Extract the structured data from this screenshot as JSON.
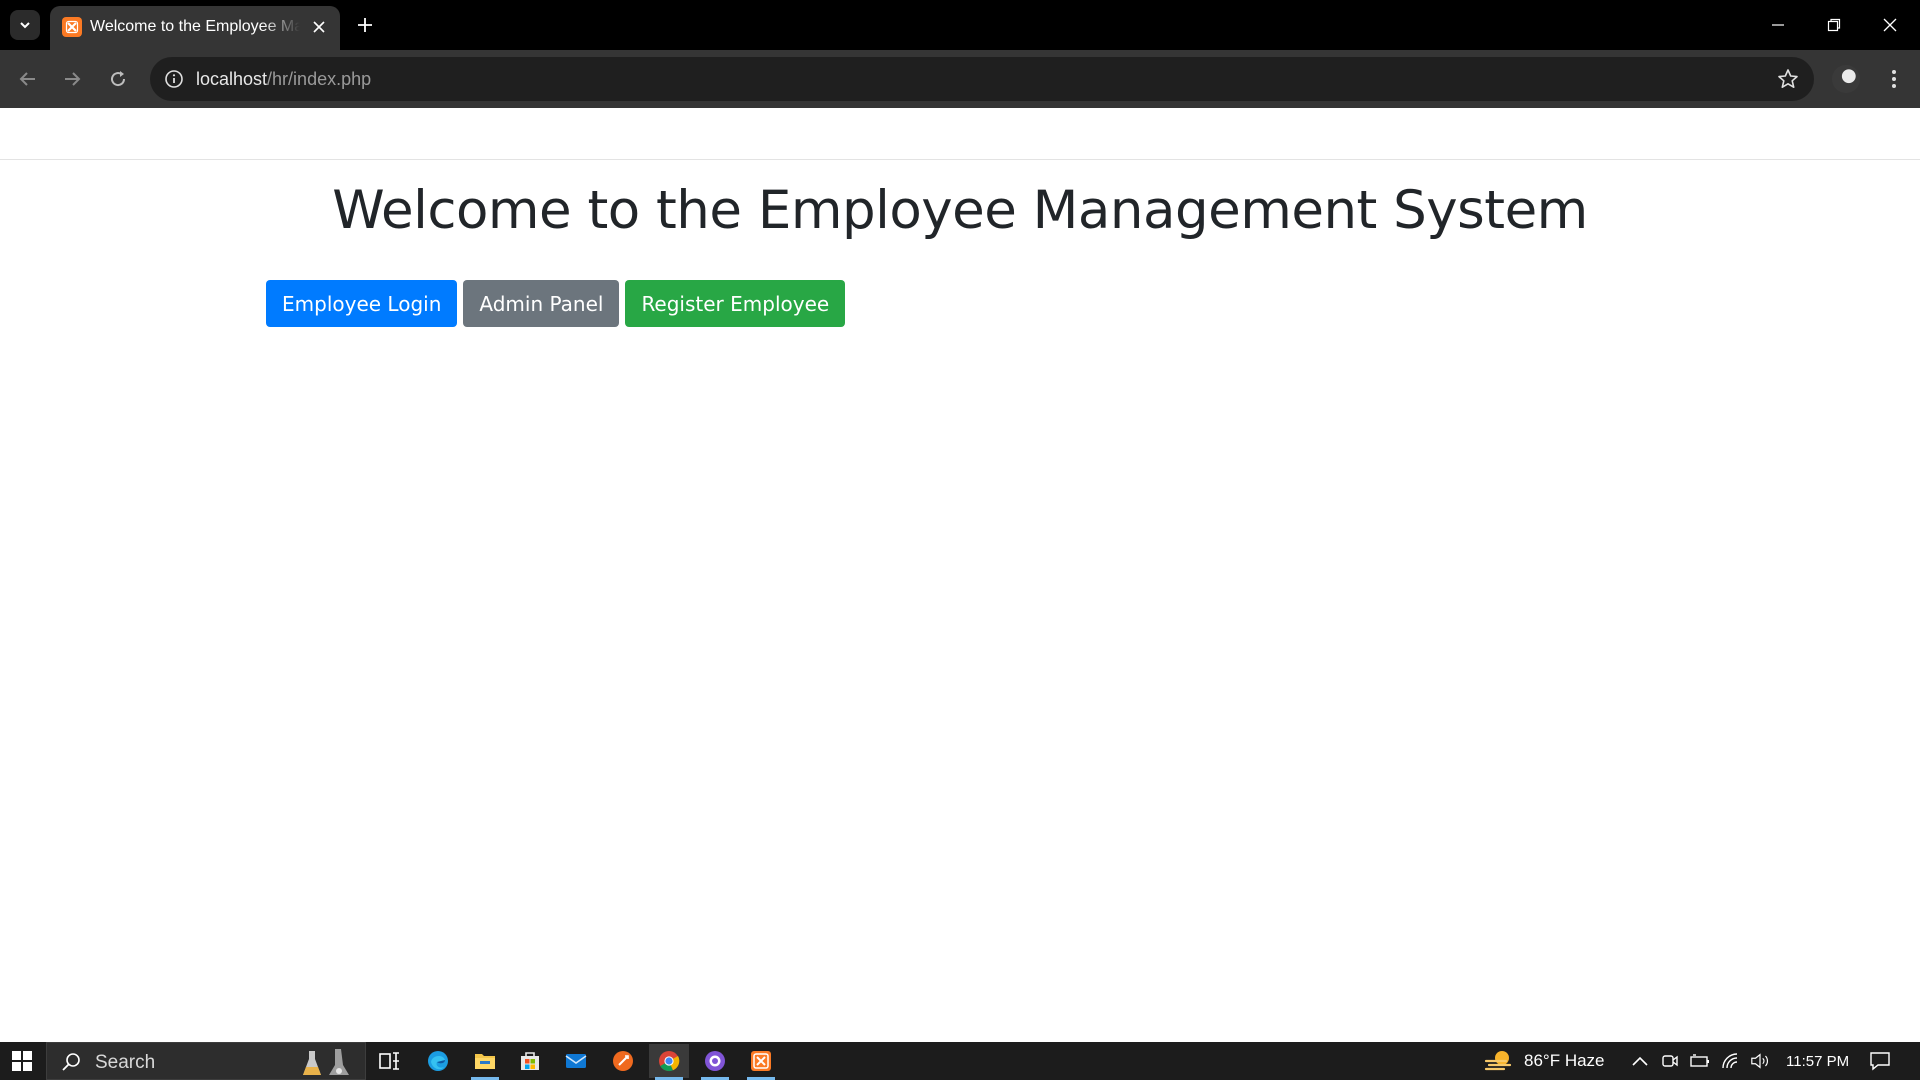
{
  "browser": {
    "tab_title": "Welcome to the Employee Management System",
    "url_host": "localhost",
    "url_path": "/hr/index.php"
  },
  "page": {
    "title": "Welcome to the Employee Management System",
    "buttons": {
      "employee_login": "Employee Login",
      "admin_panel": "Admin Panel",
      "register_employee": "Register Employee"
    },
    "colors": {
      "primary": "#007bff",
      "secondary": "#6c757d",
      "success": "#28a745",
      "heading": "#212529"
    }
  },
  "taskbar": {
    "search_label": "Search",
    "weather": "86°F  Haze",
    "time": "11:57 PM",
    "pinned_icons": [
      "task-view-icon",
      "edge-icon",
      "file-explorer-icon",
      "store-icon",
      "mail-icon",
      "brave-icon",
      "chrome-icon",
      "github-desktop-icon",
      "xampp-icon"
    ]
  }
}
